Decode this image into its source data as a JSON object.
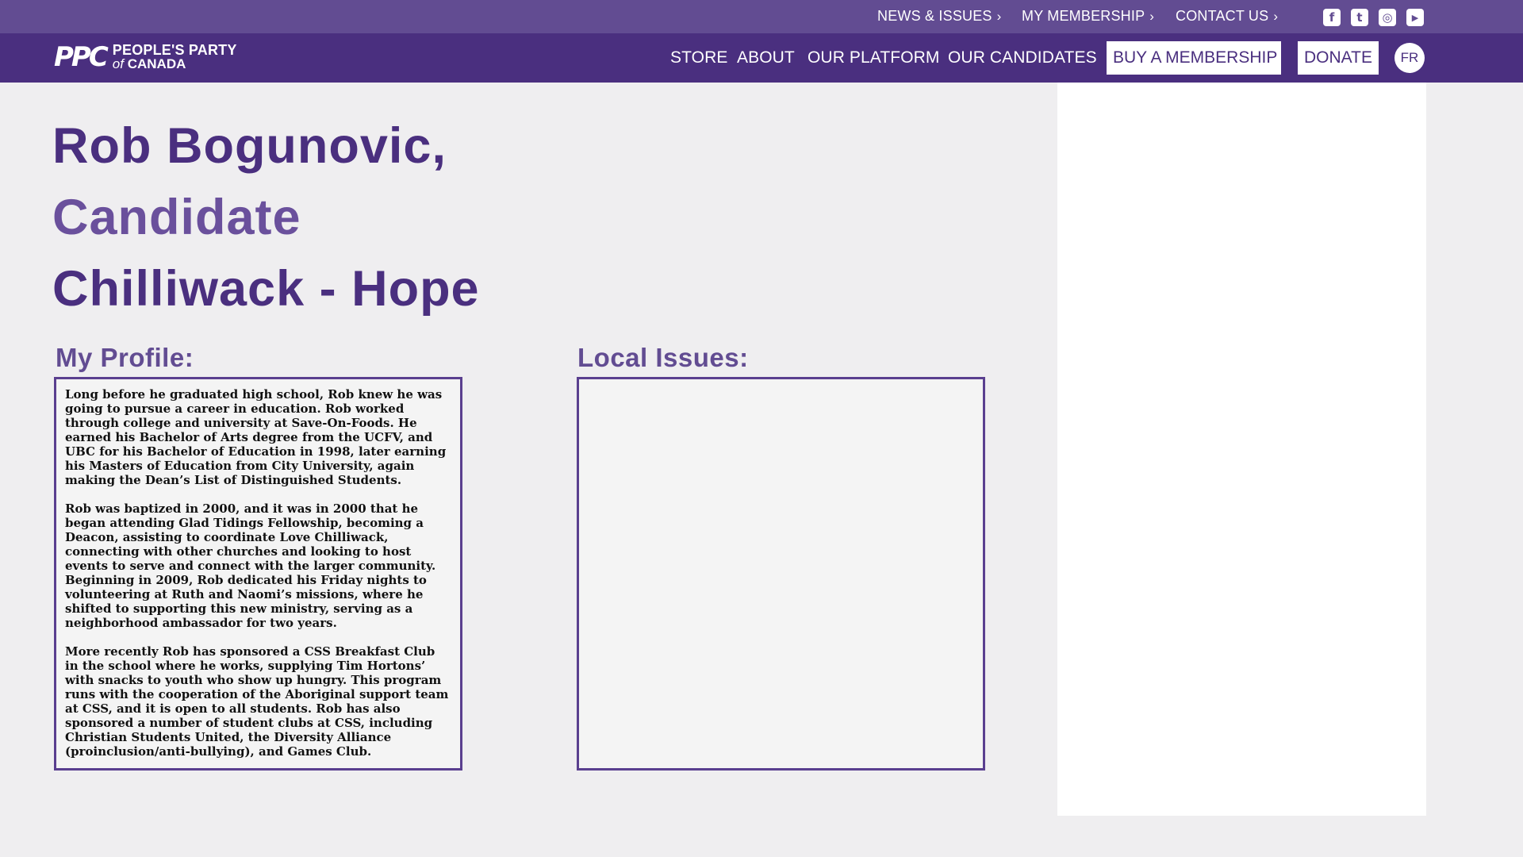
{
  "topbar": {
    "links": [
      {
        "label": "NEWS & ISSUES"
      },
      {
        "label": "MY MEMBERSHIP"
      },
      {
        "label": "CONTACT US"
      }
    ],
    "social": [
      {
        "icon": "facebook-icon",
        "glyph": "f"
      },
      {
        "icon": "twitter-icon",
        "glyph": "t"
      },
      {
        "icon": "instagram-icon",
        "glyph": "◎"
      },
      {
        "icon": "youtube-icon",
        "glyph": "▶"
      }
    ]
  },
  "nav": {
    "logo": {
      "mark": "PPC",
      "line1": "PEOPLE'S PARTY",
      "line2_prefix": "of",
      "line2": "CANADA"
    },
    "links": [
      {
        "label": "STORE"
      },
      {
        "label": "ABOUT"
      },
      {
        "label": "OUR PLATFORM"
      },
      {
        "label": "OUR CANDIDATES"
      }
    ],
    "membership_button": "BUY A MEMBERSHIP",
    "donate_button": "DONATE",
    "language_button": "FR"
  },
  "page": {
    "title_line1": "Rob Bogunovic,",
    "title_line2": "Candidate",
    "title_line3": "Chilliwack - Hope",
    "profile_heading": "My Profile:",
    "issues_heading": "Local Issues:",
    "profile_paragraphs": [
      "Long before he graduated high school, Rob knew he was going to pursue a career in education. Rob worked through college and university at Save-On-Foods. He earned his Bachelor of Arts degree from the UCFV, and UBC for his Bachelor of Education in 1998, later earning his Masters of Education from City University, again making the Dean’s List of Distinguished Students.",
      "Rob was baptized in 2000, and it was in 2000 that he began attending Glad Tidings Fellowship, becoming a Deacon, assisting to coordinate Love Chilliwack, connecting with other churches and looking to host events to serve and connect with the larger community. Beginning in 2009, Rob dedicated his Friday nights to volunteering at Ruth and Naomi’s missions, where he shifted to supporting this new ministry, serving as a neighborhood ambassador for two years.",
      "More recently Rob has sponsored a CSS Breakfast Club in the school where he works, supplying Tim Hortons’ with snacks to youth who show up hungry. This program runs with the cooperation of the Aboriginal support team at CSS, and it is open to all students. Rob has also sponsored a number of student clubs at CSS, including Christian Students United, the Diversity Alliance (proinclusion/anti-bullying), and Games Club."
    ],
    "local_issues_text": ""
  },
  "colors": {
    "topbar": "#624c92",
    "nav": "#4a2f7f",
    "accent": "#6a509c",
    "background": "#efeef0"
  }
}
